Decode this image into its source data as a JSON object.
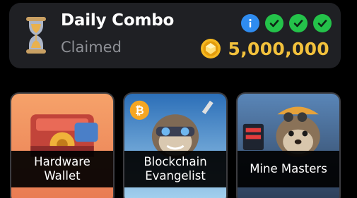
{
  "daily_combo": {
    "title": "Daily Combo",
    "status": "Claimed",
    "reward_amount": "5,000,000",
    "progress_icons": [
      "info-icon",
      "check-icon",
      "check-icon",
      "check-icon"
    ],
    "colors": {
      "accent_gold": "#f2c13c",
      "check_green": "#24c24a",
      "info_blue": "#2f8cf0"
    }
  },
  "cards": [
    {
      "label": "Hardware Wallet",
      "label_line1": "Hardware",
      "label_line2": "Wallet"
    },
    {
      "label": "Blockchain Evangelist",
      "label_line1": "Blockchain",
      "label_line2": "Evangelist"
    },
    {
      "label": "Mine Masters"
    }
  ]
}
